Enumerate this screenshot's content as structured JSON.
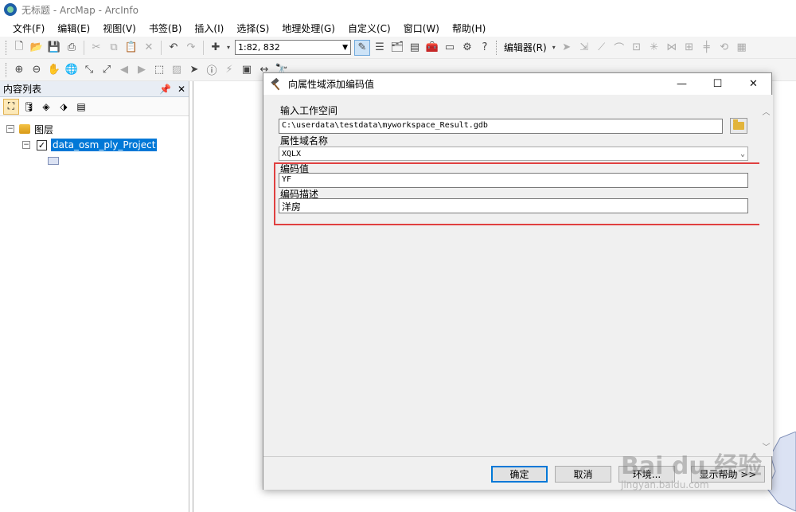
{
  "window": {
    "title": "无标题 - ArcMap - ArcInfo"
  },
  "menubar": {
    "items": [
      "文件(F)",
      "编辑(E)",
      "视图(V)",
      "书签(B)",
      "插入(I)",
      "选择(S)",
      "地理处理(G)",
      "自定义(C)",
      "窗口(W)",
      "帮助(H)"
    ]
  },
  "toolbar": {
    "scale": "1:82, 832",
    "editor_menu": "编辑器(R)"
  },
  "toc": {
    "title": "内容列表",
    "root_label": "图层",
    "layer_label": "data_osm_ply_Project",
    "layer_checked": "✓"
  },
  "dialog": {
    "title": "向属性域添加编码值",
    "fields": {
      "workspace_label": "输入工作空间",
      "workspace_value": "C:\\userdata\\testdata\\myworkspace_Result.gdb",
      "domain_label": "属性域名称",
      "domain_value": "XQLX",
      "code_label": "编码值",
      "code_value": "YF",
      "desc_label": "编码描述",
      "desc_value": "洋房"
    },
    "buttons": {
      "ok": "确定",
      "cancel": "取消",
      "env": "环境...",
      "help": "显示帮助 >>"
    }
  },
  "watermark": {
    "main": "Bai du 经验",
    "sub": "jingyan.baidu.com"
  },
  "colors": {
    "selection": "#0078d7",
    "highlight_border": "#e04040"
  }
}
